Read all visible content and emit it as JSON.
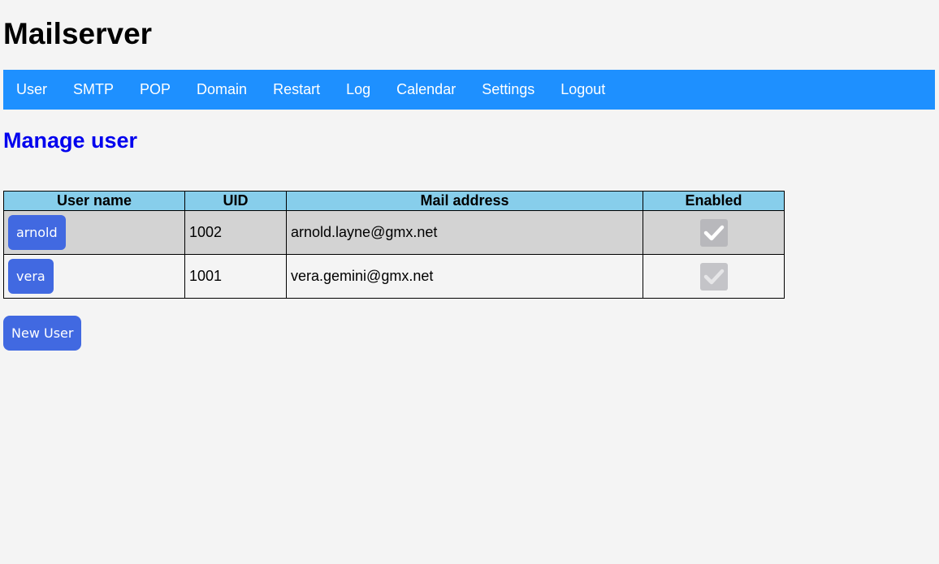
{
  "app": {
    "title": "Mailserver"
  },
  "nav": {
    "items": [
      {
        "label": "User"
      },
      {
        "label": "SMTP"
      },
      {
        "label": "POP"
      },
      {
        "label": "Domain"
      },
      {
        "label": "Restart"
      },
      {
        "label": "Log"
      },
      {
        "label": "Calendar"
      },
      {
        "label": "Settings"
      },
      {
        "label": "Logout"
      }
    ],
    "color": "#1e90ff"
  },
  "main": {
    "heading": "Manage user",
    "table": {
      "columns": [
        "User name",
        "UID",
        "Mail address",
        "Enabled"
      ],
      "rows": [
        {
          "user": "arnold",
          "uid": "1002",
          "mail": "arnold.layne@gmx.net",
          "enabled": true
        },
        {
          "user": "vera",
          "uid": "1001",
          "mail": "vera.gemini@gmx.net",
          "enabled": true
        }
      ],
      "header_color": "#87ceeb"
    },
    "new_user_label": "New User"
  },
  "colors": {
    "button": "#4169e1",
    "heading": "#0000ee",
    "checkbox_disabled": "#b8b8bc"
  }
}
